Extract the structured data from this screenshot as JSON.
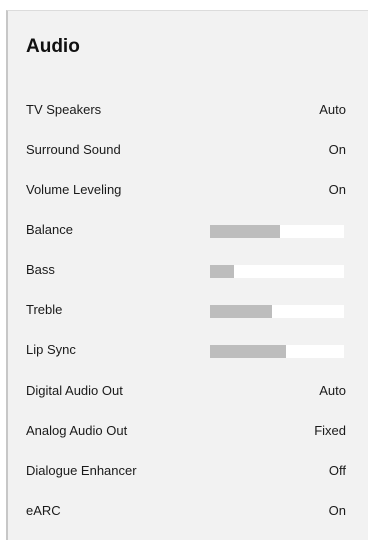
{
  "panel": {
    "title": "Audio",
    "items": [
      {
        "label": "TV Speakers",
        "value": "Auto"
      },
      {
        "label": "Surround Sound",
        "value": "On"
      },
      {
        "label": "Volume Leveling",
        "value": "On"
      },
      {
        "label": "Balance",
        "level": 0.52
      },
      {
        "label": "Bass",
        "level": 0.18
      },
      {
        "label": "Treble",
        "level": 0.46
      },
      {
        "label": "Lip Sync",
        "level": 0.57
      },
      {
        "label": "Digital Audio Out",
        "value": "Auto"
      },
      {
        "label": "Analog Audio Out",
        "value": "Fixed"
      },
      {
        "label": "Dialogue Enhancer",
        "value": "Off"
      },
      {
        "label": "eARC",
        "value": "On"
      }
    ]
  },
  "colors": {
    "panel_background": "#f2f2f2",
    "slider_track": "#ffffff",
    "slider_fill": "#bdbdbd",
    "text": "#1a1a1a"
  }
}
